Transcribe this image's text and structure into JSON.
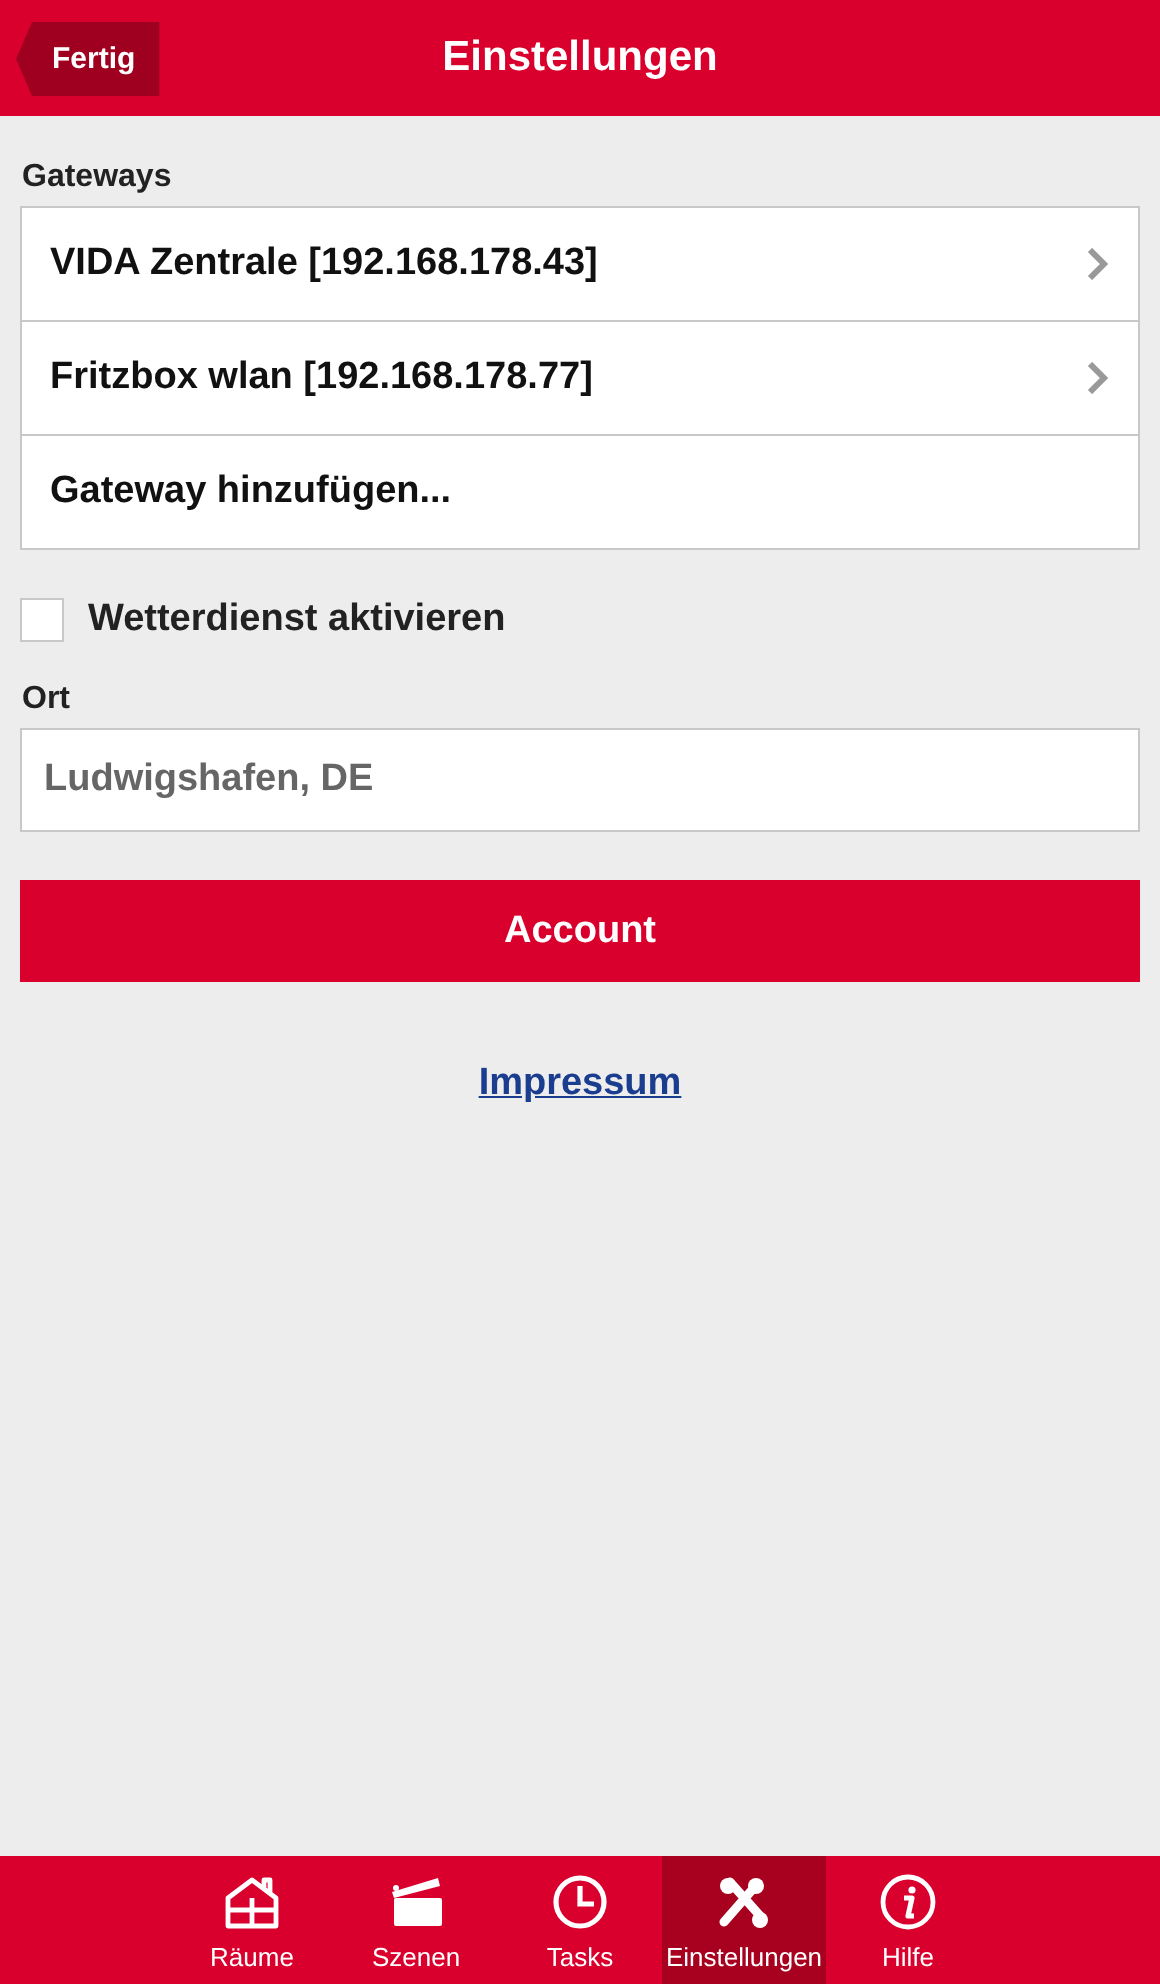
{
  "header": {
    "back_button": "Fertig",
    "title": "Einstellungen"
  },
  "gateways": {
    "label": "Gateways",
    "items": [
      {
        "label": "VIDA Zentrale [192.168.178.43]",
        "kind": "link"
      },
      {
        "label": "Fritzbox wlan [192.168.178.77]",
        "kind": "link"
      },
      {
        "label": "Gateway hinzufügen...",
        "kind": "action"
      }
    ]
  },
  "weather": {
    "label": "Wetterdienst aktivieren",
    "checked": false
  },
  "location": {
    "label": "Ort",
    "placeholder": "Ludwigshafen, DE"
  },
  "account_button": "Account",
  "imprint_link": "Impressum",
  "tab_bar": [
    {
      "label": "Räume",
      "selected": false
    },
    {
      "label": "Szenen",
      "selected": false
    },
    {
      "label": "Tasks",
      "selected": false
    },
    {
      "label": "Einstellungen",
      "selected": true
    },
    {
      "label": "Hilfe",
      "selected": false
    }
  ]
}
